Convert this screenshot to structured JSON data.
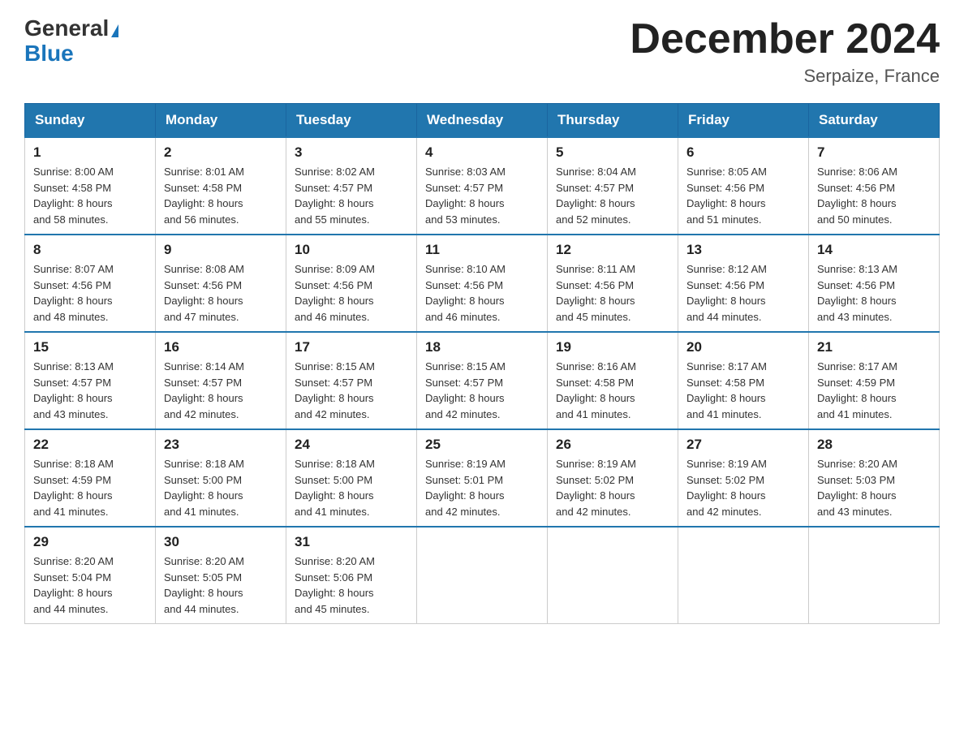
{
  "logo": {
    "general": "General",
    "blue": "Blue"
  },
  "title": {
    "month": "December 2024",
    "location": "Serpaize, France"
  },
  "days_of_week": [
    "Sunday",
    "Monday",
    "Tuesday",
    "Wednesday",
    "Thursday",
    "Friday",
    "Saturday"
  ],
  "weeks": [
    [
      {
        "day": "1",
        "sunrise": "8:00 AM",
        "sunset": "4:58 PM",
        "daylight": "8 hours and 58 minutes."
      },
      {
        "day": "2",
        "sunrise": "8:01 AM",
        "sunset": "4:58 PM",
        "daylight": "8 hours and 56 minutes."
      },
      {
        "day": "3",
        "sunrise": "8:02 AM",
        "sunset": "4:57 PM",
        "daylight": "8 hours and 55 minutes."
      },
      {
        "day": "4",
        "sunrise": "8:03 AM",
        "sunset": "4:57 PM",
        "daylight": "8 hours and 53 minutes."
      },
      {
        "day": "5",
        "sunrise": "8:04 AM",
        "sunset": "4:57 PM",
        "daylight": "8 hours and 52 minutes."
      },
      {
        "day": "6",
        "sunrise": "8:05 AM",
        "sunset": "4:56 PM",
        "daylight": "8 hours and 51 minutes."
      },
      {
        "day": "7",
        "sunrise": "8:06 AM",
        "sunset": "4:56 PM",
        "daylight": "8 hours and 50 minutes."
      }
    ],
    [
      {
        "day": "8",
        "sunrise": "8:07 AM",
        "sunset": "4:56 PM",
        "daylight": "8 hours and 48 minutes."
      },
      {
        "day": "9",
        "sunrise": "8:08 AM",
        "sunset": "4:56 PM",
        "daylight": "8 hours and 47 minutes."
      },
      {
        "day": "10",
        "sunrise": "8:09 AM",
        "sunset": "4:56 PM",
        "daylight": "8 hours and 46 minutes."
      },
      {
        "day": "11",
        "sunrise": "8:10 AM",
        "sunset": "4:56 PM",
        "daylight": "8 hours and 46 minutes."
      },
      {
        "day": "12",
        "sunrise": "8:11 AM",
        "sunset": "4:56 PM",
        "daylight": "8 hours and 45 minutes."
      },
      {
        "day": "13",
        "sunrise": "8:12 AM",
        "sunset": "4:56 PM",
        "daylight": "8 hours and 44 minutes."
      },
      {
        "day": "14",
        "sunrise": "8:13 AM",
        "sunset": "4:56 PM",
        "daylight": "8 hours and 43 minutes."
      }
    ],
    [
      {
        "day": "15",
        "sunrise": "8:13 AM",
        "sunset": "4:57 PM",
        "daylight": "8 hours and 43 minutes."
      },
      {
        "day": "16",
        "sunrise": "8:14 AM",
        "sunset": "4:57 PM",
        "daylight": "8 hours and 42 minutes."
      },
      {
        "day": "17",
        "sunrise": "8:15 AM",
        "sunset": "4:57 PM",
        "daylight": "8 hours and 42 minutes."
      },
      {
        "day": "18",
        "sunrise": "8:15 AM",
        "sunset": "4:57 PM",
        "daylight": "8 hours and 42 minutes."
      },
      {
        "day": "19",
        "sunrise": "8:16 AM",
        "sunset": "4:58 PM",
        "daylight": "8 hours and 41 minutes."
      },
      {
        "day": "20",
        "sunrise": "8:17 AM",
        "sunset": "4:58 PM",
        "daylight": "8 hours and 41 minutes."
      },
      {
        "day": "21",
        "sunrise": "8:17 AM",
        "sunset": "4:59 PM",
        "daylight": "8 hours and 41 minutes."
      }
    ],
    [
      {
        "day": "22",
        "sunrise": "8:18 AM",
        "sunset": "4:59 PM",
        "daylight": "8 hours and 41 minutes."
      },
      {
        "day": "23",
        "sunrise": "8:18 AM",
        "sunset": "5:00 PM",
        "daylight": "8 hours and 41 minutes."
      },
      {
        "day": "24",
        "sunrise": "8:18 AM",
        "sunset": "5:00 PM",
        "daylight": "8 hours and 41 minutes."
      },
      {
        "day": "25",
        "sunrise": "8:19 AM",
        "sunset": "5:01 PM",
        "daylight": "8 hours and 42 minutes."
      },
      {
        "day": "26",
        "sunrise": "8:19 AM",
        "sunset": "5:02 PM",
        "daylight": "8 hours and 42 minutes."
      },
      {
        "day": "27",
        "sunrise": "8:19 AM",
        "sunset": "5:02 PM",
        "daylight": "8 hours and 42 minutes."
      },
      {
        "day": "28",
        "sunrise": "8:20 AM",
        "sunset": "5:03 PM",
        "daylight": "8 hours and 43 minutes."
      }
    ],
    [
      {
        "day": "29",
        "sunrise": "8:20 AM",
        "sunset": "5:04 PM",
        "daylight": "8 hours and 44 minutes."
      },
      {
        "day": "30",
        "sunrise": "8:20 AM",
        "sunset": "5:05 PM",
        "daylight": "8 hours and 44 minutes."
      },
      {
        "day": "31",
        "sunrise": "8:20 AM",
        "sunset": "5:06 PM",
        "daylight": "8 hours and 45 minutes."
      },
      null,
      null,
      null,
      null
    ]
  ],
  "labels": {
    "sunrise": "Sunrise:",
    "sunset": "Sunset:",
    "daylight": "Daylight:"
  }
}
